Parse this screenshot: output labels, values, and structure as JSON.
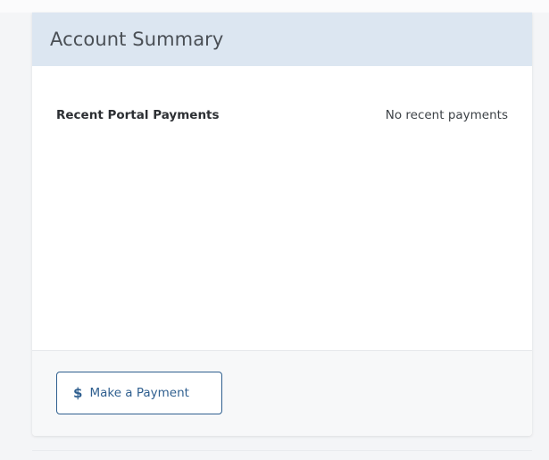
{
  "account_summary": {
    "title": "Account Summary",
    "rows": [
      {
        "label": "Recent Portal Payments",
        "value": "No recent payments"
      }
    ]
  },
  "footer": {
    "payment_button": {
      "icon": "dollar-icon",
      "icon_glyph": "$",
      "label": "Make a Payment"
    }
  },
  "colors": {
    "header_bg": "#dce6f1",
    "accent": "#2f5f8f"
  }
}
